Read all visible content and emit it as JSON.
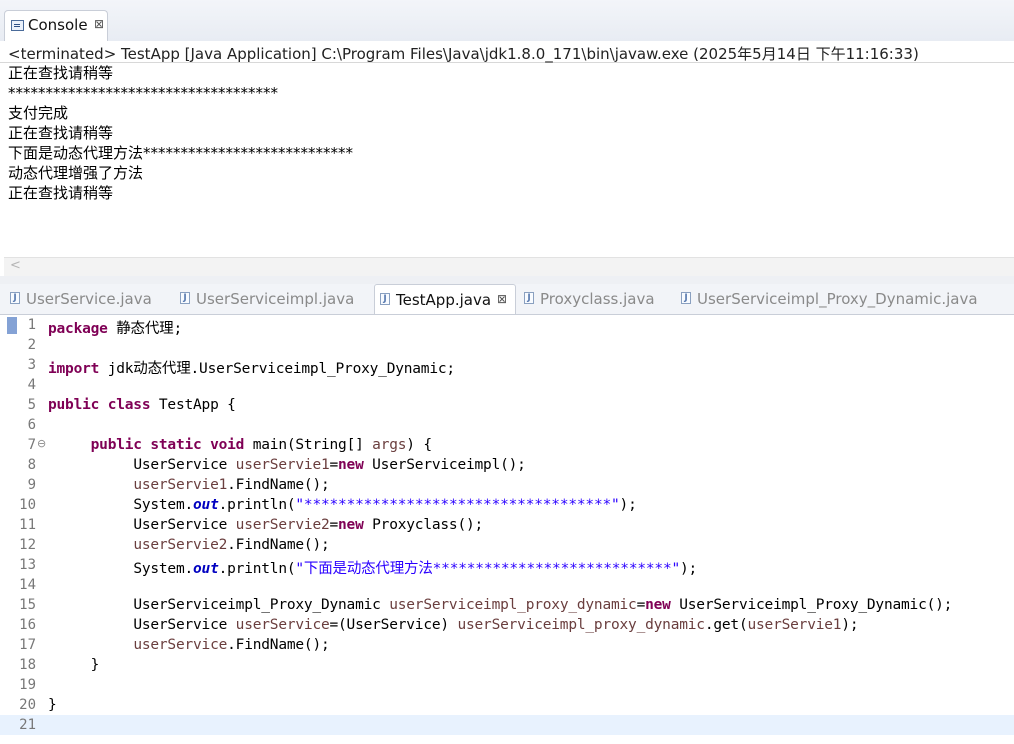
{
  "console": {
    "tab_label": "Console",
    "tab_close": "⊠",
    "header": "<terminated> TestApp [Java Application] C:\\Program Files\\Java\\jdk1.8.0_171\\bin\\javaw.exe (2025年5月14日 下午11:16:33)",
    "output": [
      "正在查找请稍等",
      "************************************",
      "支付完成",
      "正在查找请稍等",
      "下面是动态代理方法****************************",
      "动态代理增强了方法",
      "正在查找请稍等"
    ],
    "scroll_left": "<"
  },
  "editor": {
    "tabs": [
      {
        "label": "UserService.java"
      },
      {
        "label": "UserServiceimpl.java"
      },
      {
        "label": "TestApp.java"
      },
      {
        "label": "Proxyclass.java"
      },
      {
        "label": "UserServiceimpl_Proxy_Dynamic.java"
      }
    ],
    "active_tab": "TestApp.java",
    "tab_close": "⊠",
    "line_numbers": [
      "1",
      "2",
      "3",
      "4",
      "5",
      "6",
      "7",
      "8",
      "9",
      "10",
      "11",
      "12",
      "13",
      "14",
      "15",
      "16",
      "17",
      "18",
      "19",
      "20",
      "21"
    ],
    "code": {
      "l1_kw": "package",
      "l1_rest": " 静态代理;",
      "l3_kw": "import",
      "l3_rest": " jdk动态代理.UserServiceimpl_Proxy_Dynamic;",
      "l5_kw1": "public",
      "l5_kw2": "class",
      "l5_rest": " TestApp {",
      "l7_kw1": "public",
      "l7_kw2": "static",
      "l7_kw3": "void",
      "l7_rest1": " main(String[] ",
      "l7_var": "args",
      "l7_rest2": ") {",
      "l8_t1": "UserService ",
      "l8_var": "userServie1",
      "l8_eq": "=",
      "l8_kw": "new",
      "l8_rest": " UserServiceimpl();",
      "l9_var": "userServie1",
      "l9_rest": ".FindName();",
      "l10_t1": "System.",
      "l10_fld": "out",
      "l10_t2": ".println(",
      "l10_str": "\"************************************\"",
      "l10_end": ");",
      "l11_t1": "UserService ",
      "l11_var": "userServie2",
      "l11_eq": "=",
      "l11_kw": "new",
      "l11_rest": " Proxyclass();",
      "l12_var": "userServie2",
      "l12_rest": ".FindName();",
      "l13_t1": "System.",
      "l13_fld": "out",
      "l13_t2": ".println(",
      "l13_str": "\"下面是动态代理方法****************************\"",
      "l13_end": ");",
      "l15_t1": "UserServiceimpl_Proxy_Dynamic ",
      "l15_var": "userServiceimpl_proxy_dynamic",
      "l15_eq": "=",
      "l15_kw": "new",
      "l15_rest": " UserServiceimpl_Proxy_Dynamic();",
      "l16_t1": "UserService ",
      "l16_var": "userService",
      "l16_t2": "=(UserService) ",
      "l16_var2": "userServiceimpl_proxy_dynamic",
      "l16_t3": ".get(",
      "l16_var3": "userServie1",
      "l16_end": ");",
      "l17_var": "userService",
      "l17_rest": ".FindName();",
      "l18": "}",
      "l20": "}"
    }
  },
  "colors": {
    "keyword": "#7f0055",
    "string": "#2a00ff",
    "local_var": "#6a3e3e",
    "static_field": "#0000c0",
    "line_number": "#787878",
    "current_line": "#e8f2fe"
  }
}
